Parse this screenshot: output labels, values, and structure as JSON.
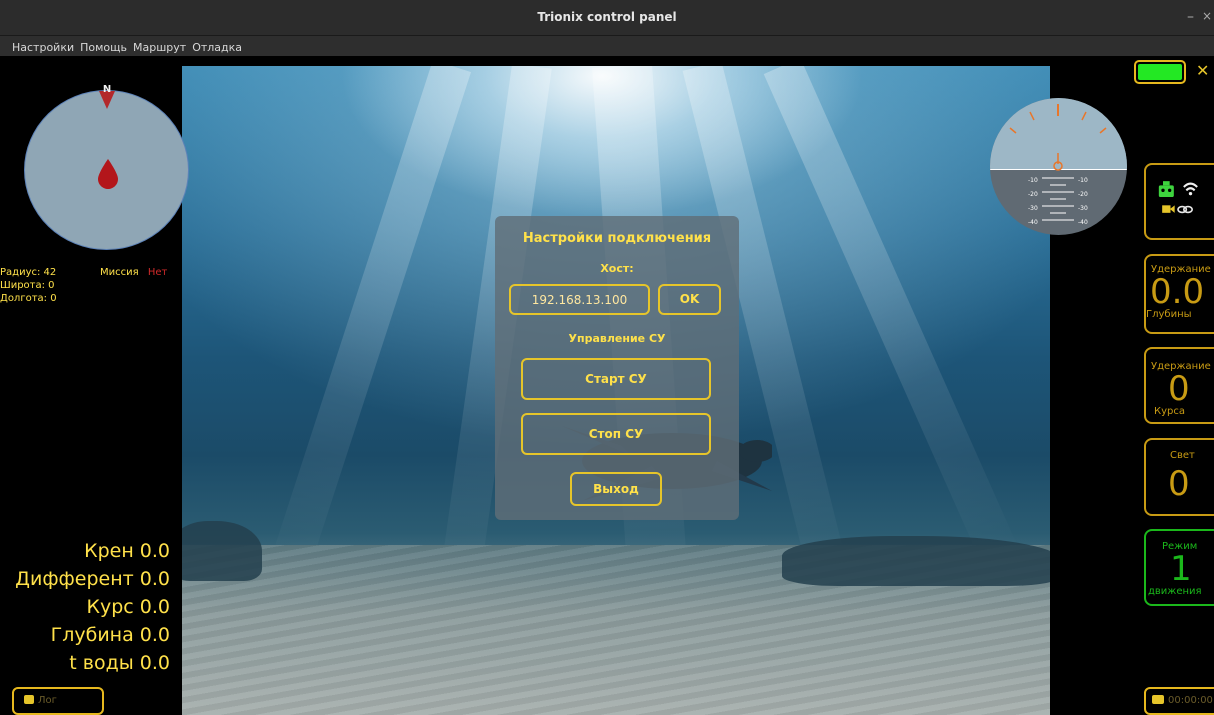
{
  "window": {
    "title": "Trionix control panel",
    "minimize": "–",
    "close": "×"
  },
  "menu": [
    "Настройки",
    "Помощь",
    "Маршрут",
    "Отладка"
  ],
  "compass": {
    "north": "N"
  },
  "nav_info": {
    "radius_label": "Радиус:",
    "radius_value": "42",
    "mission_label": "Миссия",
    "mission_value": "Нет",
    "lat_label": "Широта:",
    "lat_value": "0",
    "lon_label": "Долгота:",
    "lon_value": "0"
  },
  "telemetry": {
    "roll": "Крен 0.0",
    "pitch": "Дифферент 0.0",
    "course": "Курс 0.0",
    "depth": "Глубина 0.0",
    "water_temp": "t воды 0.0"
  },
  "log_button": "Лог",
  "attitude_ticks": {
    "left": [
      "-10",
      "-20",
      "-30",
      "-40"
    ],
    "right": [
      "-10",
      "-20",
      "-30",
      "-40"
    ]
  },
  "battery_color": "#23e823",
  "panels": {
    "depth_hold": {
      "top": "Удержание",
      "value": "0.0",
      "bottom": "Глубины"
    },
    "course_hold": {
      "top": "Удержание",
      "value": "0",
      "bottom": "Курса"
    },
    "light": {
      "top": "Свет",
      "value": "0"
    },
    "mode": {
      "top": "Режим",
      "value": "1",
      "bottom": "движения"
    }
  },
  "record_button": "00:00:00",
  "dialog": {
    "title": "Настройки подключения",
    "host_label": "Хост:",
    "host_value": "192.168.13.100",
    "ok": "OK",
    "su_label": "Управление СУ",
    "start": "Старт СУ",
    "stop": "Стоп СУ",
    "exit": "Выход"
  }
}
